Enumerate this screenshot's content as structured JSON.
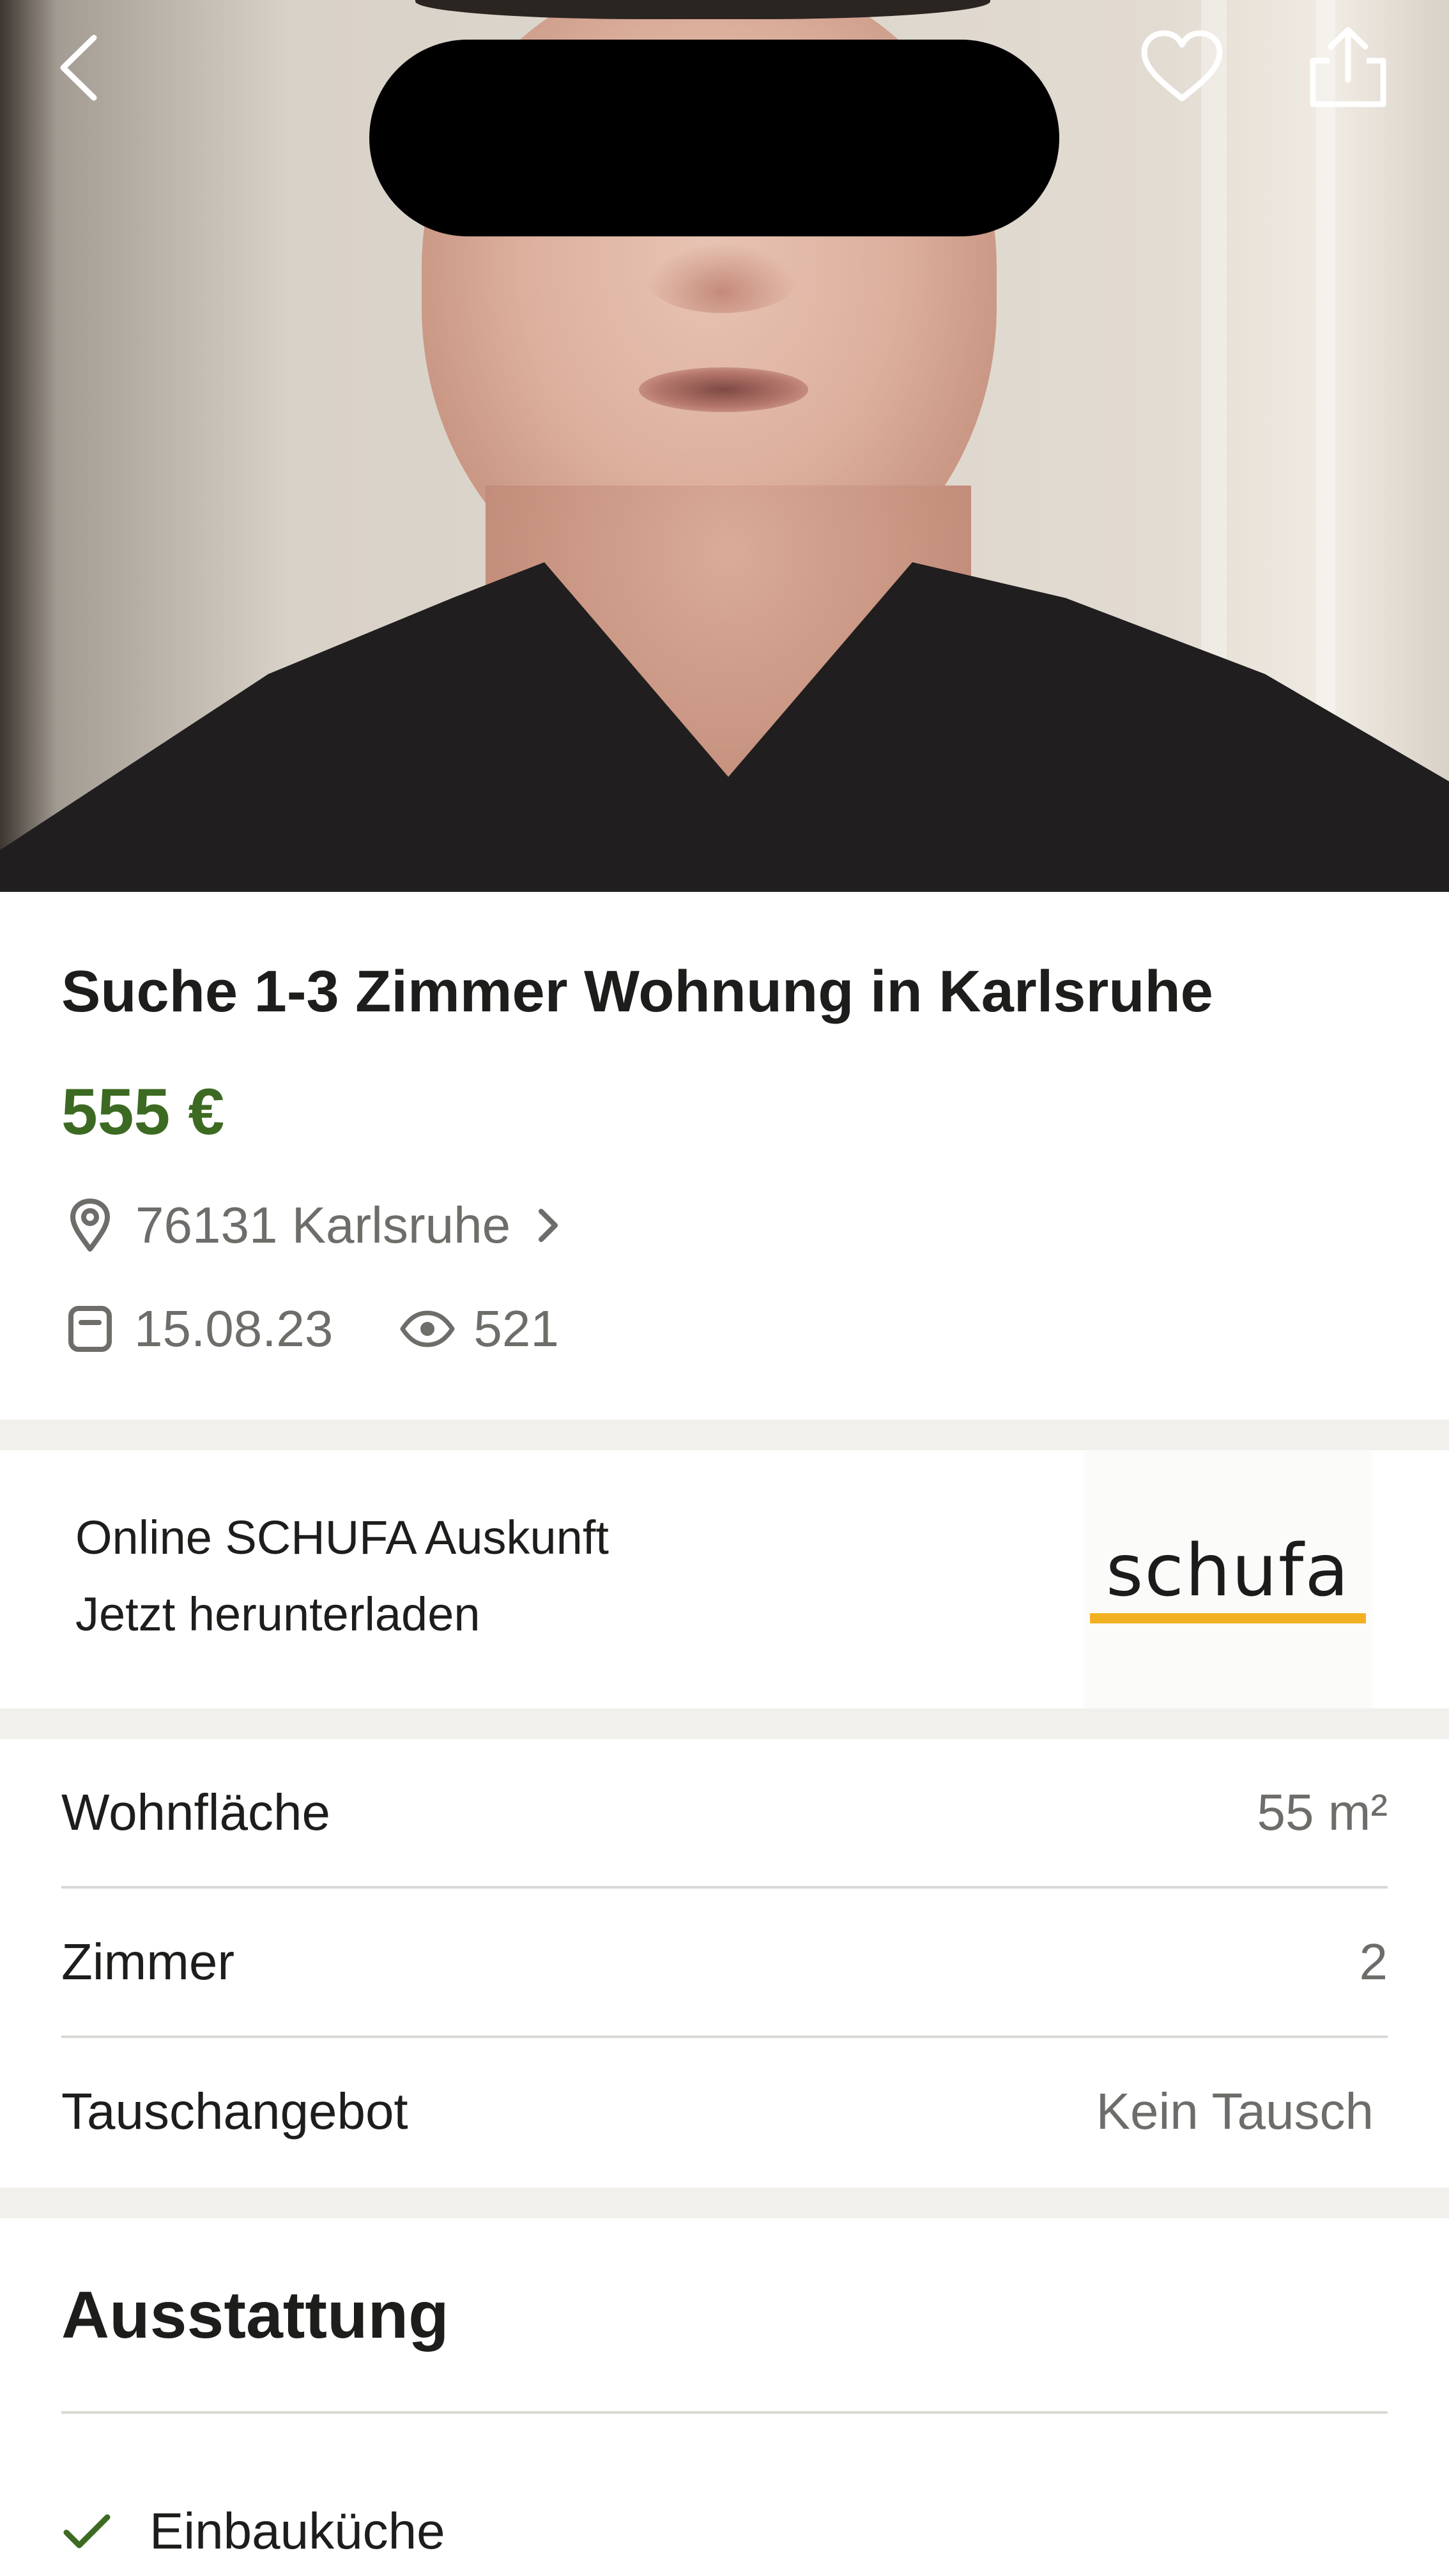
{
  "listing": {
    "title": "Suche 1-3 Zimmer Wohnung in Karlsruhe",
    "price": "555 €",
    "location": "76131 Karlsruhe",
    "date": "15.08.23",
    "views": "521"
  },
  "ad": {
    "title": "Online SCHUFA Auskunft",
    "cta": "Jetzt herunterladen",
    "logo_text": "schufa"
  },
  "attributes": [
    {
      "label": "Wohnfläche",
      "value": "55 m²"
    },
    {
      "label": "Zimmer",
      "value": "2"
    },
    {
      "label": "Tauschangebot",
      "value": "Kein Tausch"
    }
  ],
  "features": {
    "title": "Ausstattung",
    "items": [
      "Einbauküche"
    ]
  },
  "colors": {
    "price_green": "#3c6a22",
    "check_green": "#3c6a22",
    "text": "#1d1d1b",
    "muted": "#6e6d69",
    "divider": "#f1f0ec",
    "schufa_yellow": "#f2b122"
  },
  "icons": {
    "back": "chevron-left-icon",
    "favorite": "heart-icon",
    "share": "share-icon",
    "location": "map-pin-icon",
    "date": "calendar-icon",
    "views": "eye-icon",
    "feature_check": "check-icon"
  }
}
